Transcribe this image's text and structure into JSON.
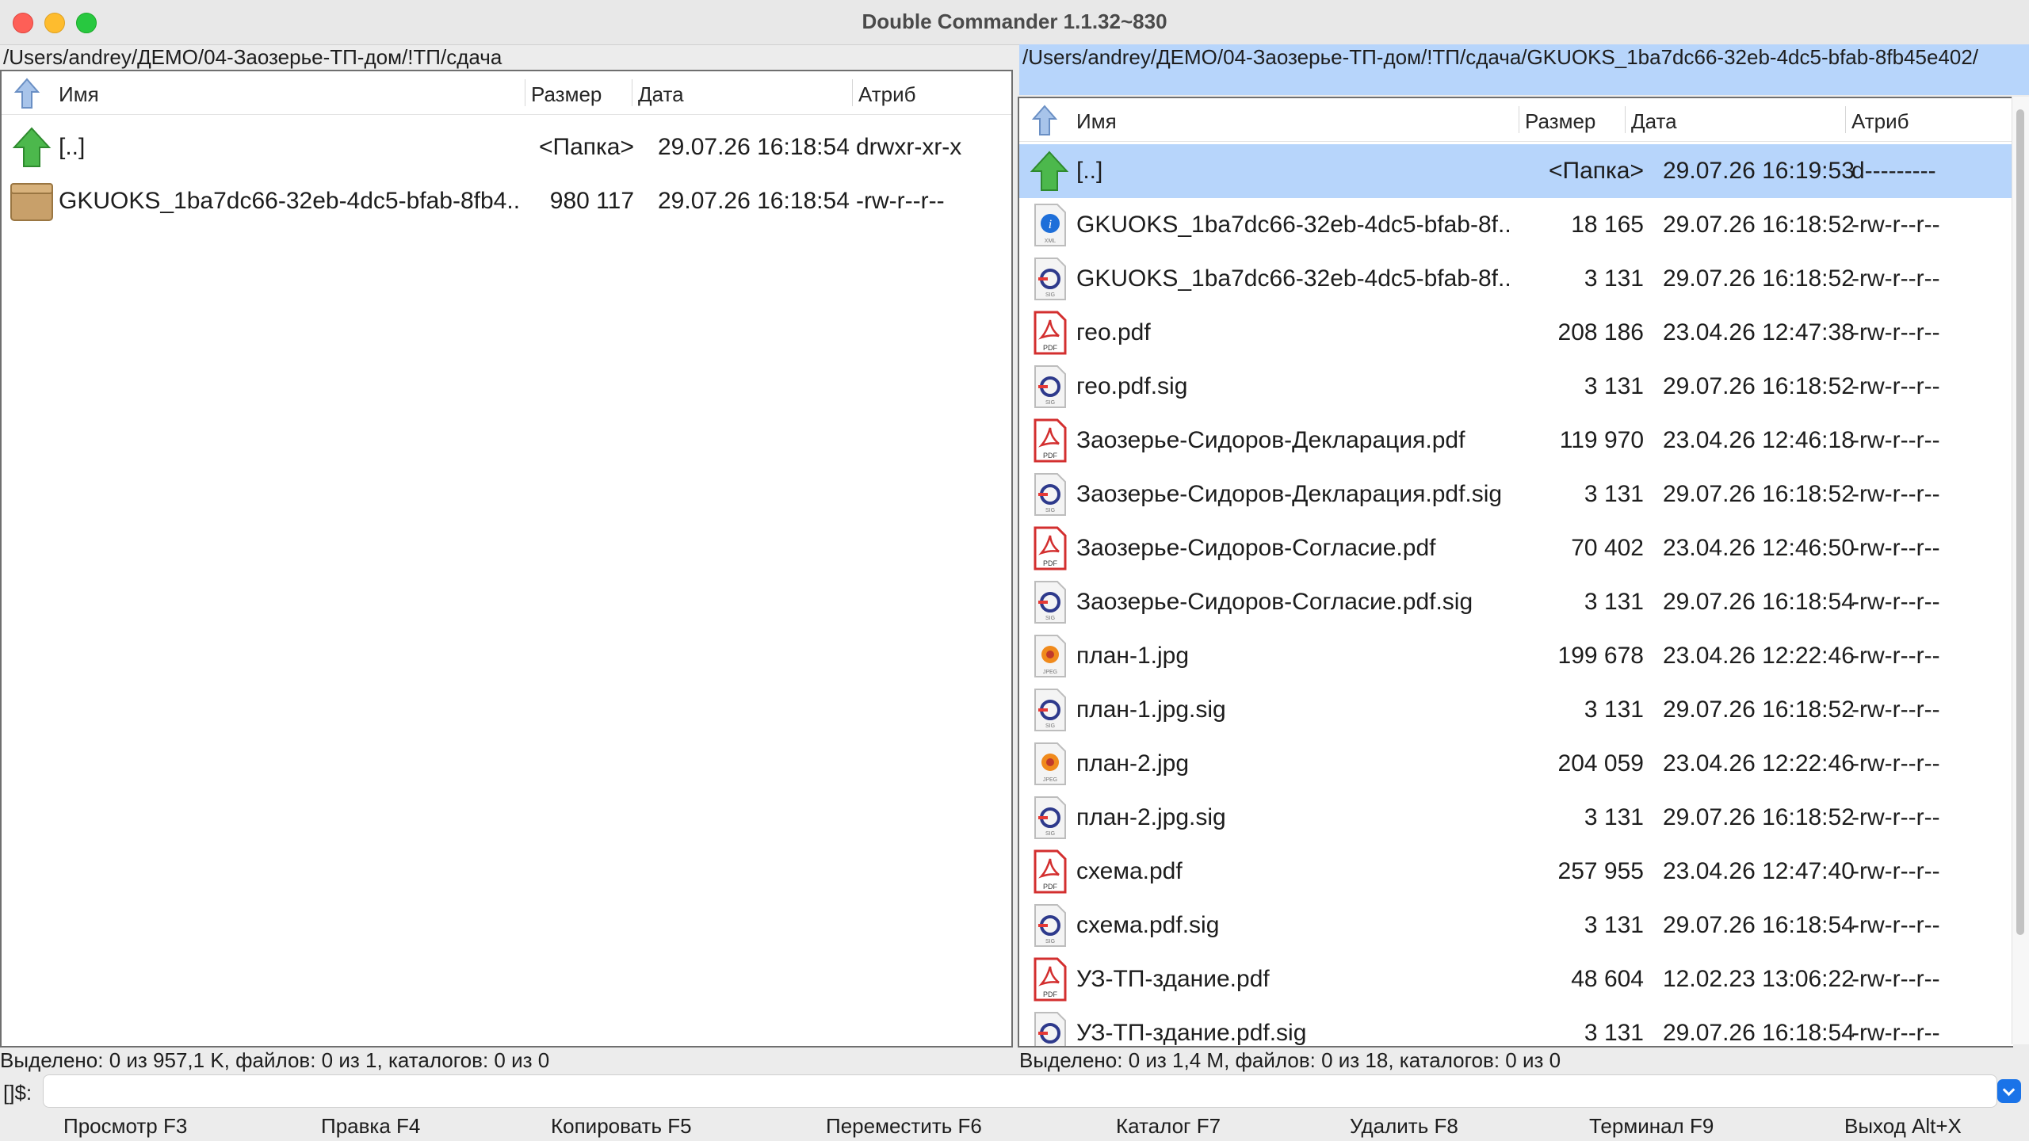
{
  "window": {
    "title": "Double Commander 1.1.32~830"
  },
  "left": {
    "path": "/Users/andrey/ДЕМО/04-Заозерье-ТП-дом/!ТП/сдача",
    "columns": {
      "name": "Имя",
      "size": "Размер",
      "date": "Дата",
      "attr": "Атриб"
    },
    "rows": [
      {
        "icon": "folder-up-icon",
        "name": "[..]",
        "size": "<Папка>",
        "date": "29.07.26 16:18:54",
        "attr": "drwxr-xr-x"
      },
      {
        "icon": "archive-icon",
        "name": "GKUOKS_1ba7dc66-32eb-4dc5-bfab-8fb4..",
        "size": "980 117",
        "date": "29.07.26 16:18:54",
        "attr": "-rw-r--r--"
      }
    ],
    "status": "Выделено: 0 из 957,1 K, файлов: 0 из 1, каталогов: 0 из 0"
  },
  "right": {
    "path": "/Users/andrey/ДЕМО/04-Заозерье-ТП-дом/!ТП/сдача/GKUOKS_1ba7dc66-32eb-4dc5-bfab-8fb45e402/",
    "columns": {
      "name": "Имя",
      "size": "Размер",
      "date": "Дата",
      "attr": "Атриб"
    },
    "rows": [
      {
        "icon": "folder-up-icon",
        "name": "[..]",
        "size": "<Папка>",
        "date": "29.07.26 16:19:53",
        "attr": "d---------"
      },
      {
        "icon": "xml-icon",
        "name": "GKUOKS_1ba7dc66-32eb-4dc5-bfab-8f..",
        "size": "18 165",
        "date": "29.07.26 16:18:52",
        "attr": "-rw-r--r--"
      },
      {
        "icon": "sig-icon",
        "name": "GKUOKS_1ba7dc66-32eb-4dc5-bfab-8f..",
        "size": "3 131",
        "date": "29.07.26 16:18:52",
        "attr": "-rw-r--r--"
      },
      {
        "icon": "pdf-icon",
        "name": "гео.pdf",
        "size": "208 186",
        "date": "23.04.26 12:47:38",
        "attr": "-rw-r--r--"
      },
      {
        "icon": "sig-icon",
        "name": "гео.pdf.sig",
        "size": "3 131",
        "date": "29.07.26 16:18:52",
        "attr": "-rw-r--r--"
      },
      {
        "icon": "pdf-icon",
        "name": "Заозерье-Сидоров-Декларация.pdf",
        "size": "119 970",
        "date": "23.04.26 12:46:18",
        "attr": "-rw-r--r--"
      },
      {
        "icon": "sig-icon",
        "name": "Заозерье-Сидоров-Декларация.pdf.sig",
        "size": "3 131",
        "date": "29.07.26 16:18:52",
        "attr": "-rw-r--r--"
      },
      {
        "icon": "pdf-icon",
        "name": "Заозерье-Сидоров-Согласие.pdf",
        "size": "70 402",
        "date": "23.04.26 12:46:50",
        "attr": "-rw-r--r--"
      },
      {
        "icon": "sig-icon",
        "name": "Заозерье-Сидоров-Согласие.pdf.sig",
        "size": "3 131",
        "date": "29.07.26 16:18:54",
        "attr": "-rw-r--r--"
      },
      {
        "icon": "jpeg-icon",
        "name": "план-1.jpg",
        "size": "199 678",
        "date": "23.04.26 12:22:46",
        "attr": "-rw-r--r--"
      },
      {
        "icon": "sig-icon",
        "name": "план-1.jpg.sig",
        "size": "3 131",
        "date": "29.07.26 16:18:52",
        "attr": "-rw-r--r--"
      },
      {
        "icon": "jpeg-icon",
        "name": "план-2.jpg",
        "size": "204 059",
        "date": "23.04.26 12:22:46",
        "attr": "-rw-r--r--"
      },
      {
        "icon": "sig-icon",
        "name": "план-2.jpg.sig",
        "size": "3 131",
        "date": "29.07.26 16:18:52",
        "attr": "-rw-r--r--"
      },
      {
        "icon": "pdf-icon",
        "name": "схема.pdf",
        "size": "257 955",
        "date": "23.04.26 12:47:40",
        "attr": "-rw-r--r--"
      },
      {
        "icon": "sig-icon",
        "name": "схема.pdf.sig",
        "size": "3 131",
        "date": "29.07.26 16:18:54",
        "attr": "-rw-r--r--"
      },
      {
        "icon": "pdf-icon",
        "name": "УЗ-ТП-здание.pdf",
        "size": "48 604",
        "date": "12.02.23 13:06:22",
        "attr": "-rw-r--r--"
      },
      {
        "icon": "sig-icon",
        "name": "УЗ-ТП-здание.pdf.sig",
        "size": "3 131",
        "date": "29.07.26 16:18:54",
        "attr": "-rw-r--r--"
      }
    ],
    "status": "Выделено: 0 из 1,4 M, файлов: 0 из 18, каталогов: 0 из 0"
  },
  "command": {
    "label": "[]$:",
    "value": ""
  },
  "fkeys": [
    "Просмотр F3",
    "Правка F4",
    "Копировать F5",
    "Переместить F6",
    "Каталог F7",
    "Удалить F8",
    "Терминал F9",
    "Выход Alt+X"
  ],
  "colors": {
    "selection": "#b7d5fb",
    "pdf": "#d32f2f",
    "sig": "#2e3a8c",
    "folder_up": "#3ca33c"
  }
}
